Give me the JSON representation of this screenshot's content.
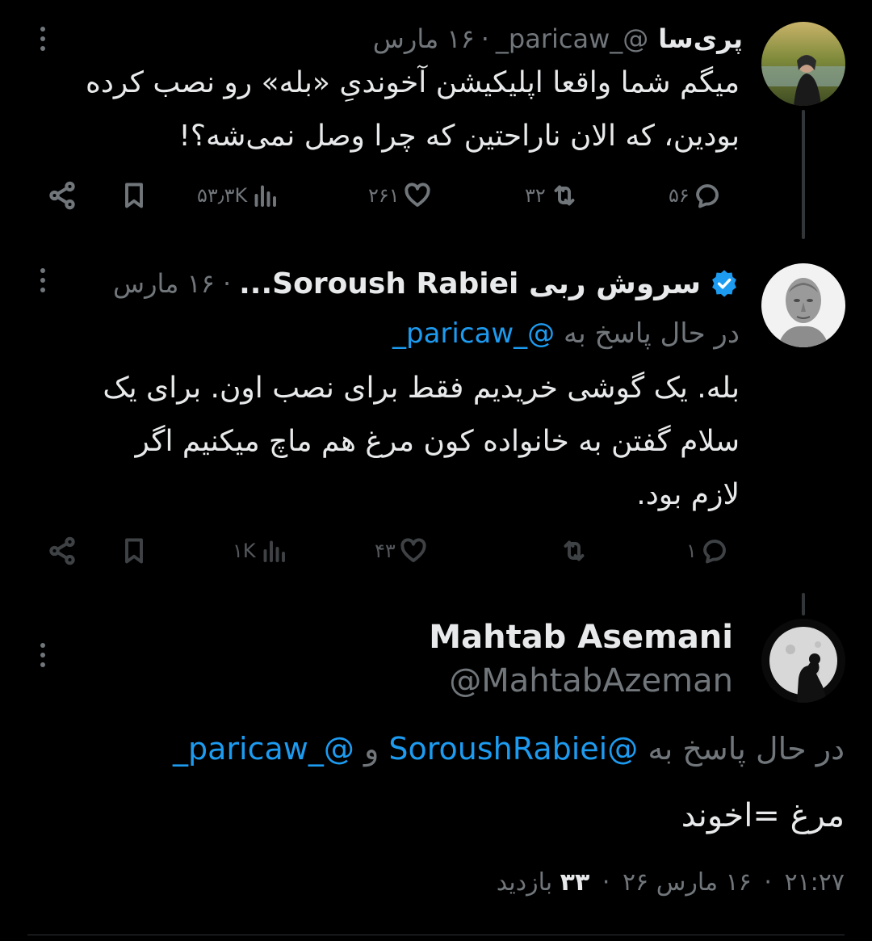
{
  "tweet1": {
    "display_name": "پری‌سا",
    "handle": "@_paricaw_",
    "date": "۱۶ مارس",
    "text_line1": "میگم شما واقعا اپلیکیشن آخوندیِ «بله» رو نصب کرده",
    "text_line2": "بودین، که الان ناراحتین که چرا وصل نمی‌شه؟!",
    "replies": "۵۶",
    "reposts": "۳۲",
    "likes": "۲۶۱",
    "views": "۵۳٫۳K"
  },
  "tweet2": {
    "display_name": "سروش ربی Soroush Rabiei...",
    "date": "۱۶ مارس",
    "replying_prefix": "در حال پاسخ به",
    "replying_to": "@_paricaw_",
    "text_line1": "بله. یک گوشی خریدیم فقط برای نصب اون. برای یک",
    "text_line2": "سلام گفتن به خانواده کون مرغ هم ماچ میکنیم اگر",
    "text_line3": "لازم بود.",
    "replies": "۱",
    "reposts": "",
    "likes": "۴۳",
    "views": "۱K"
  },
  "tweet3": {
    "display_name": "Mahtab Asemani",
    "handle": "@MahtabAzeman",
    "replying_prefix": "در حال پاسخ به",
    "replying_to_1": "@SoroushRabiei",
    "replying_and": "و",
    "replying_to_2": "@_paricaw_",
    "text": "مرغ =اخوند",
    "time": "۲۱:۲۷",
    "date": "۱۶ مارس ۲۶",
    "views_count": "۳۳",
    "views_label": "بازدید"
  },
  "icons": [
    "more-dots-icon",
    "reply-icon",
    "repost-icon",
    "like-icon",
    "views-icon",
    "bookmark-icon",
    "share-icon",
    "verified-icon"
  ],
  "colors": {
    "background": "#000000",
    "text": "#e7e9ea",
    "muted": "#71767b",
    "link": "#1d9bf0"
  }
}
